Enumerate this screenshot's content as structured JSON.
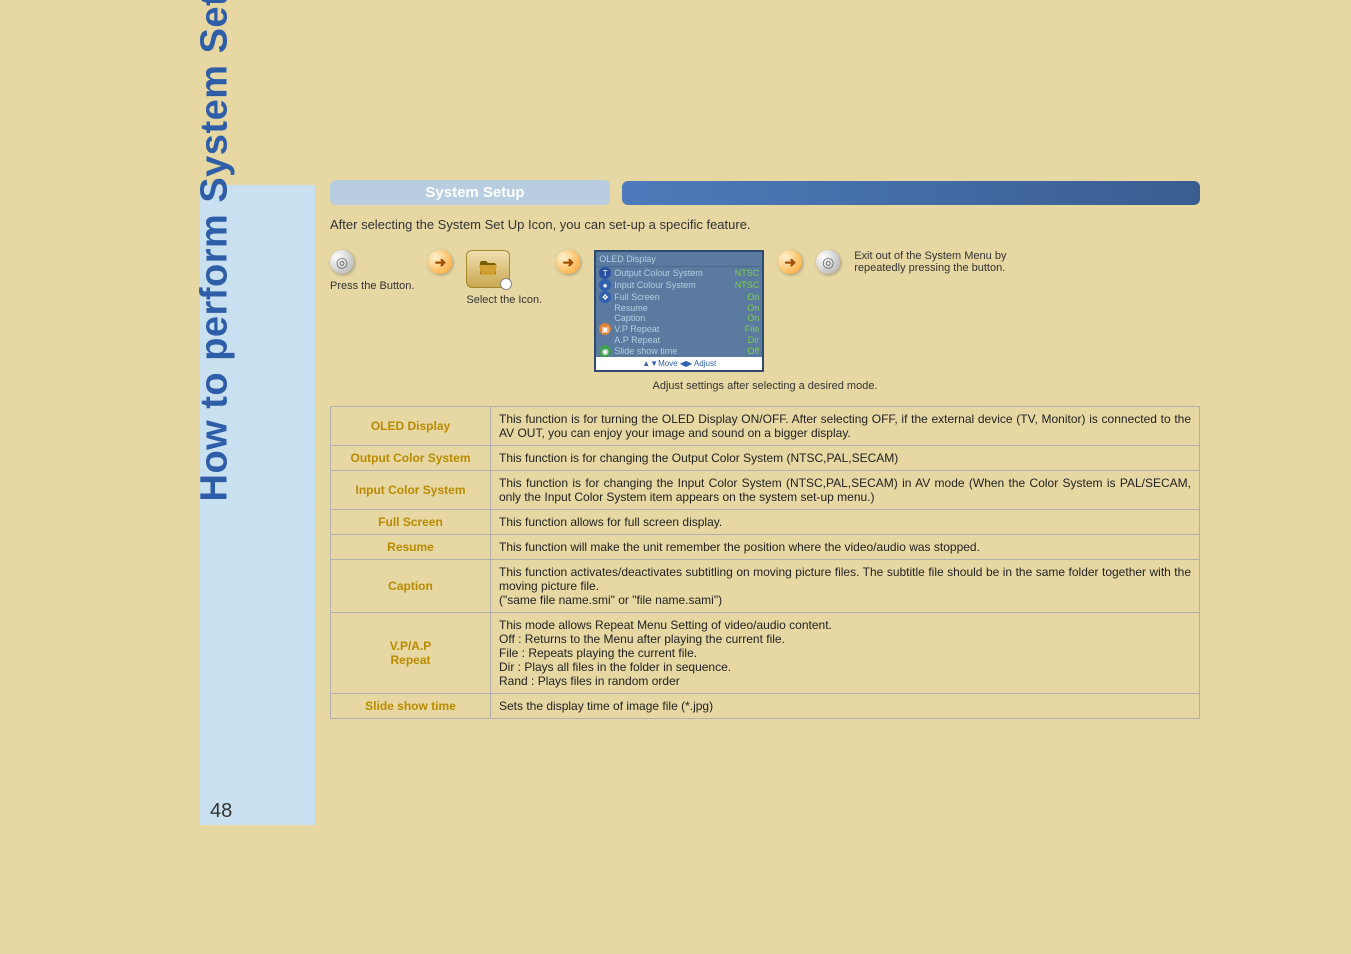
{
  "side_title": "How to perform System Set Up",
  "page_number": "48",
  "section_title": "System Setup",
  "intro_text": "After selecting the System Set Up Icon, you can set-up a specific feature.",
  "steps": {
    "press_button": "Press the Button.",
    "select_icon": "Select the Icon.",
    "exit_text": "Exit out of the System Menu by repeatedly pressing the button."
  },
  "osd": {
    "banner": "OLED Display",
    "rows": [
      {
        "label": "Output Colour System",
        "value": "NTSC"
      },
      {
        "label": "Input Colour System",
        "value": "NTSC"
      },
      {
        "label": "Full Screen",
        "value": "On"
      },
      {
        "label": "Resume",
        "value": "On"
      },
      {
        "label": "Caption",
        "value": "On"
      },
      {
        "label": "V.P Repeat",
        "value": "File"
      },
      {
        "label": "A.P Repeat",
        "value": "Dir"
      },
      {
        "label": "Slide show time",
        "value": "Off"
      }
    ],
    "hint": "▲▼Move  ◀▶  Adjust"
  },
  "osd_caption": "Adjust settings after selecting a desired mode.",
  "table": [
    {
      "label": "OLED Display",
      "desc": "This function is for turning the OLED Display ON/OFF.  After selecting OFF, if the external device (TV, Monitor) is connected to the AV OUT, you can enjoy your image and sound on a bigger display."
    },
    {
      "label": "Output Color System",
      "desc": "This function is for changing the Output Color System (NTSC,PAL,SECAM)"
    },
    {
      "label": "Input Color System",
      "desc": "This function is for changing the Input Color System (NTSC,PAL,SECAM) in AV mode (When the Color System is PAL/SECAM, only the Input Color System item appears on the system set-up menu.)"
    },
    {
      "label": "Full Screen",
      "desc": "This function allows for full screen display."
    },
    {
      "label": "Resume",
      "desc": "This function will make the unit remember the position where the video/audio was stopped."
    },
    {
      "label": "Caption",
      "desc": "This function activates/deactivates subtitling on moving picture files.  The subtitle file should be in the same folder together with the moving picture file.\n(\"same file name.smi\" or \"file name.sami\")"
    },
    {
      "label": "V.P/A.P\nRepeat",
      "desc": "This mode allows Repeat Menu Setting of video/audio content.\nOff : Returns to the Menu after playing the current file.\nFile : Repeats playing the current file.\nDir : Plays all files in the folder in sequence.\nRand : Plays files in random order"
    },
    {
      "label": "Slide show time",
      "desc": "Sets the display time of image file (*.jpg)"
    }
  ]
}
